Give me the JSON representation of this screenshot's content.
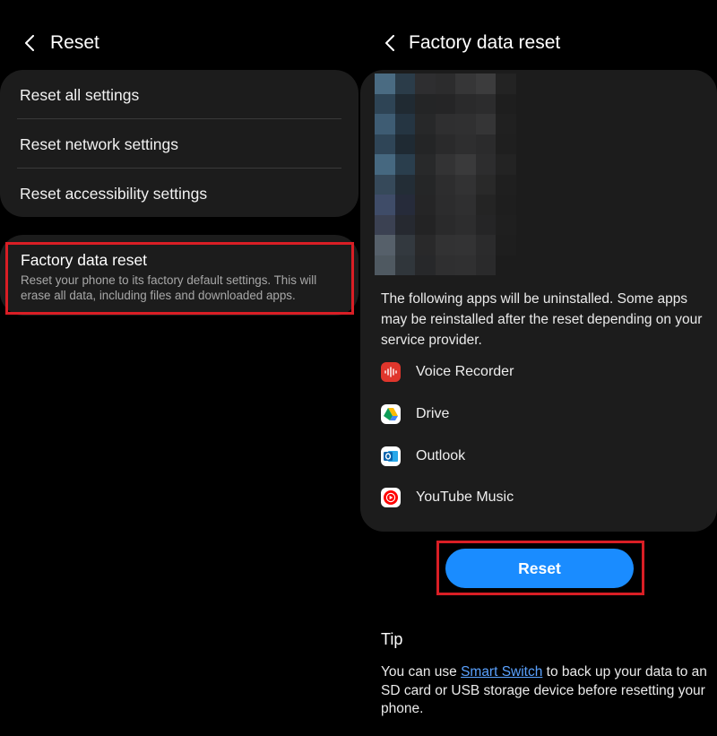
{
  "left_panel": {
    "title": "Reset",
    "menu_items": [
      {
        "label": "Reset all settings"
      },
      {
        "label": "Reset network settings"
      },
      {
        "label": "Reset accessibility settings"
      }
    ],
    "factory_reset": {
      "title": "Factory data reset",
      "description": "Reset your phone to its factory default settings. This will erase all data, including files and downloaded apps."
    }
  },
  "right_panel": {
    "title": "Factory data reset",
    "uninstall_text": "The following apps will be uninstalled. Some apps may be reinstalled after the reset depending on your service provider.",
    "apps": [
      {
        "name": "Voice Recorder",
        "icon": "voice-recorder-icon"
      },
      {
        "name": "Drive",
        "icon": "google-drive-icon"
      },
      {
        "name": "Outlook",
        "icon": "outlook-icon"
      },
      {
        "name": "YouTube Music",
        "icon": "youtube-music-icon"
      }
    ],
    "reset_button_label": "Reset",
    "tip": {
      "title": "Tip",
      "prefix": "You can use ",
      "link_text": "Smart Switch",
      "suffix": " to back up your data to an SD card or USB storage device before resetting your phone."
    }
  },
  "colors": {
    "background": "#000000",
    "card": "#1c1c1c",
    "accent_button": "#1a8cff",
    "highlight_outline": "#d91e25",
    "link": "#5aa2ff"
  }
}
